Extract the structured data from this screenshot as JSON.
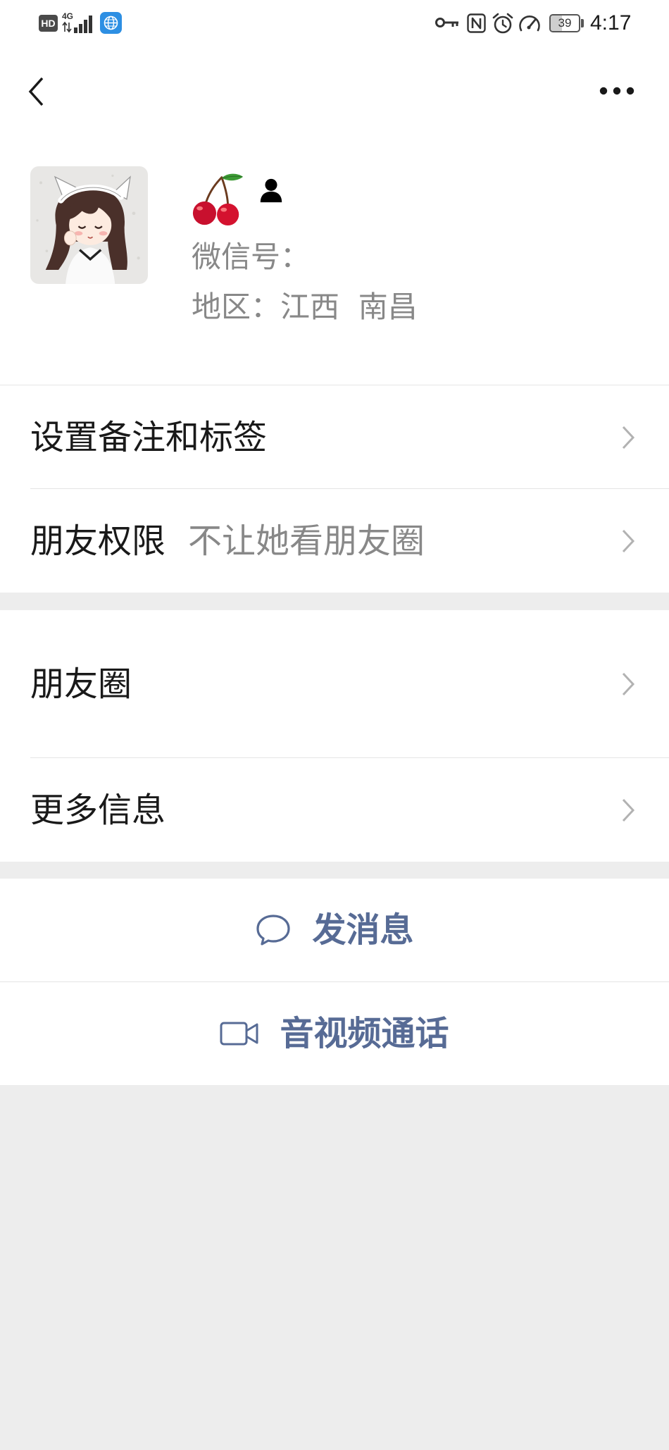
{
  "status_bar": {
    "hd_label": "HD",
    "network_type": "4G",
    "battery_level": "39",
    "time": "4:17",
    "icons": {
      "hd": "hd-icon",
      "signal": "signal-icon",
      "app": "browser-app-icon",
      "key": "key-icon",
      "nfc": "nfc-icon",
      "alarm": "alarm-icon",
      "speed": "speedometer-icon",
      "battery": "battery-icon"
    }
  },
  "header": {
    "back_icon": "chevron-left-icon",
    "more_icon": "more-dots-icon"
  },
  "profile": {
    "avatar": "avatar-image",
    "nickname_icon": "cherry-icon",
    "gender_icon": "female-icon",
    "wechat_id_label": "微信号：",
    "region": "地区：江西  南昌"
  },
  "menu_group_1": [
    {
      "label": "设置备注和标签"
    },
    {
      "label": "朋友权限",
      "value": "不让她看朋友圈"
    }
  ],
  "menu_group_2": [
    {
      "label": "朋友圈"
    },
    {
      "label": "更多信息"
    }
  ],
  "actions": [
    {
      "label": "发消息",
      "icon": "chat-bubble-icon"
    },
    {
      "label": "音视频通话",
      "icon": "video-call-icon"
    }
  ],
  "colors": {
    "link": "#576b95",
    "text": "#191919",
    "secondary": "#888888",
    "bg": "#ededed",
    "gender": "#f1694f",
    "chevron": "#b2b2b2"
  }
}
